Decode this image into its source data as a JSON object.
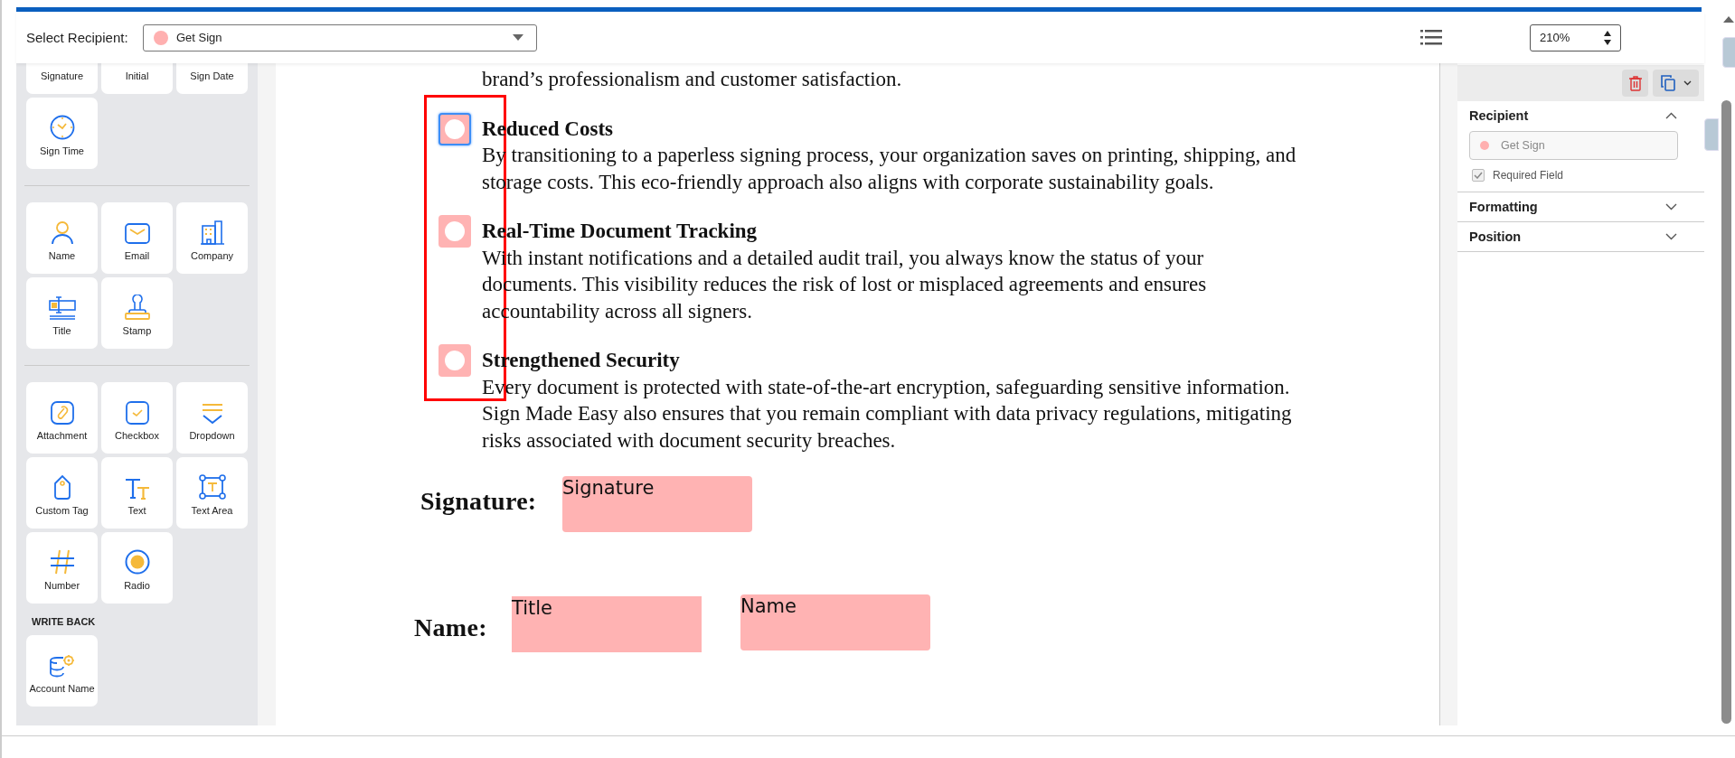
{
  "toolbar": {
    "recipient_label": "Select Recipient:",
    "recipient": {
      "name": "Get Sign",
      "color": "#ffb0b0"
    },
    "zoom": "210%"
  },
  "palette": {
    "groups": [
      {
        "items": [
          {
            "label": "Signature"
          },
          {
            "label": "Initial"
          },
          {
            "label": "Sign Date"
          },
          {
            "label": "Sign Time",
            "kind": "clock"
          }
        ]
      },
      {
        "items": [
          {
            "label": "Name",
            "kind": "person"
          },
          {
            "label": "Email",
            "kind": "mail"
          },
          {
            "label": "Company",
            "kind": "building"
          },
          {
            "label": "Title",
            "kind": "title"
          },
          {
            "label": "Stamp",
            "kind": "stamp"
          }
        ]
      },
      {
        "items": [
          {
            "label": "Attachment",
            "kind": "clip"
          },
          {
            "label": "Checkbox",
            "kind": "check"
          },
          {
            "label": "Dropdown",
            "kind": "dropdown"
          },
          {
            "label": "Custom Tag",
            "kind": "tag"
          },
          {
            "label": "Text",
            "kind": "text"
          },
          {
            "label": "Text Area",
            "kind": "textarea"
          },
          {
            "label": "Number",
            "kind": "number"
          },
          {
            "label": "Radio",
            "kind": "radio"
          }
        ]
      }
    ],
    "write_back": {
      "heading": "WRITE BACK",
      "items": [
        {
          "label": "Account Name",
          "kind": "database"
        }
      ]
    }
  },
  "document": {
    "intro": "brand’s professionalism and customer satisfaction.",
    "sections": [
      {
        "heading": "Reduced Costs",
        "body_lines": [
          "By transitioning to a paperless signing process, your organization saves on printing, shipping, and",
          "storage costs. This eco-friendly approach also aligns with corporate sustainability goals."
        ],
        "radio_field": {
          "selected": true
        }
      },
      {
        "heading": "Real-Time Document Tracking",
        "body_lines": [
          "With instant notifications and a detailed audit trail, you always know the status of your",
          "documents. This visibility reduces the risk of lost or misplaced agreements and ensures",
          "accountability across all signers."
        ],
        "radio_field": {
          "selected": false
        }
      },
      {
        "heading": "Strengthened Security",
        "body_lines": [
          "Every document is protected with state-of-the-art encryption, safeguarding sensitive information.",
          "Sign Made Easy also ensures that you remain compliant with data privacy regulations, mitigating",
          "risks associated with document security breaches."
        ],
        "radio_field": {
          "selected": false
        }
      }
    ],
    "signature_label": "Signature:",
    "name_label": "Name:",
    "fields": [
      {
        "kind": "signature",
        "label": "Signature"
      },
      {
        "kind": "title",
        "label": "Title"
      },
      {
        "kind": "name",
        "label": "Name"
      }
    ]
  },
  "properties": {
    "sections": [
      {
        "title": "Recipient",
        "expanded": true,
        "recipient": {
          "name": "Get Sign",
          "color": "#ffb0b0"
        },
        "required": {
          "label": "Required Field",
          "checked": true
        }
      },
      {
        "title": "Formatting",
        "expanded": false
      },
      {
        "title": "Position",
        "expanded": false
      }
    ]
  }
}
